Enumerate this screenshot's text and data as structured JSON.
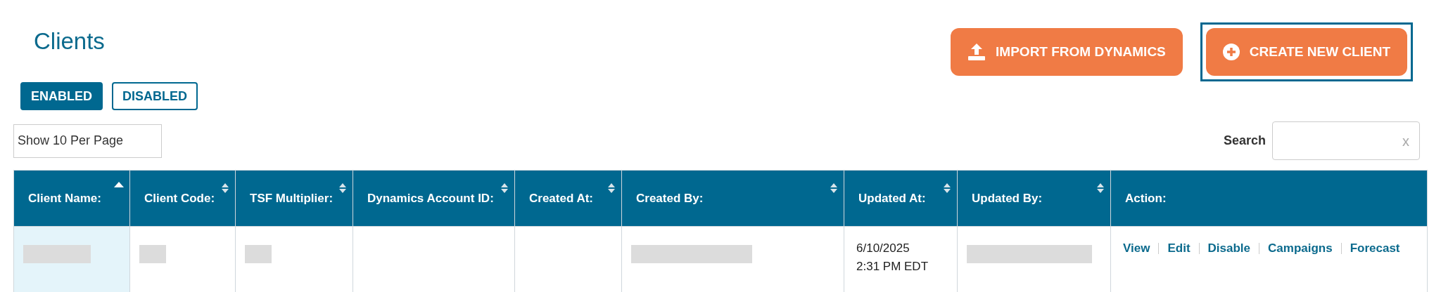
{
  "page_title": "Clients",
  "header_buttons": [
    {
      "kind": "upload",
      "label": "IMPORT FROM DYNAMICS",
      "focused": false
    },
    {
      "kind": "add",
      "label": "CREATE NEW CLIENT",
      "focused": true
    }
  ],
  "tabs": [
    {
      "label": "ENABLED",
      "selected": true
    },
    {
      "label": "DISABLED",
      "selected": false
    }
  ],
  "page_size": {
    "value": "Show 10 Per Page"
  },
  "search": {
    "label": "Search",
    "clear": "x"
  },
  "table": {
    "columns": [
      {
        "label": "Client Name:",
        "sortable": true,
        "sorted_ascending": true
      },
      {
        "label": "Client Code:",
        "sortable": true,
        "sorted_ascending": false
      },
      {
        "label": "TSF Multiplier:",
        "sortable": true,
        "sorted_ascending": false
      },
      {
        "label": "Dynamics Account ID:",
        "sortable": true,
        "sorted_ascending": false
      },
      {
        "label": "Created At:",
        "sortable": true,
        "sorted_ascending": false
      },
      {
        "label": "Created By:",
        "sortable": true,
        "sorted_ascending": false
      },
      {
        "label": "Updated At:",
        "sortable": true,
        "sorted_ascending": false
      },
      {
        "label": "Updated By:",
        "sortable": true,
        "sorted_ascending": false
      },
      {
        "label": "Action:",
        "sortable": false,
        "sorted_ascending": false
      }
    ],
    "rows": [
      {
        "cells": [
          {
            "kind": "redacted"
          },
          {
            "kind": "redacted"
          },
          {
            "kind": "redacted"
          },
          {
            "kind": "empty"
          },
          {
            "kind": "empty"
          },
          {
            "kind": "redacted"
          },
          {
            "kind": "text",
            "lines": [
              "6/10/2025",
              "2:31 PM EDT"
            ]
          },
          {
            "kind": "redacted"
          },
          {
            "kind": "actions",
            "links": [
              "View",
              "Edit",
              "Disable",
              "Campaigns",
              "Forecast"
            ]
          }
        ]
      }
    ]
  }
}
